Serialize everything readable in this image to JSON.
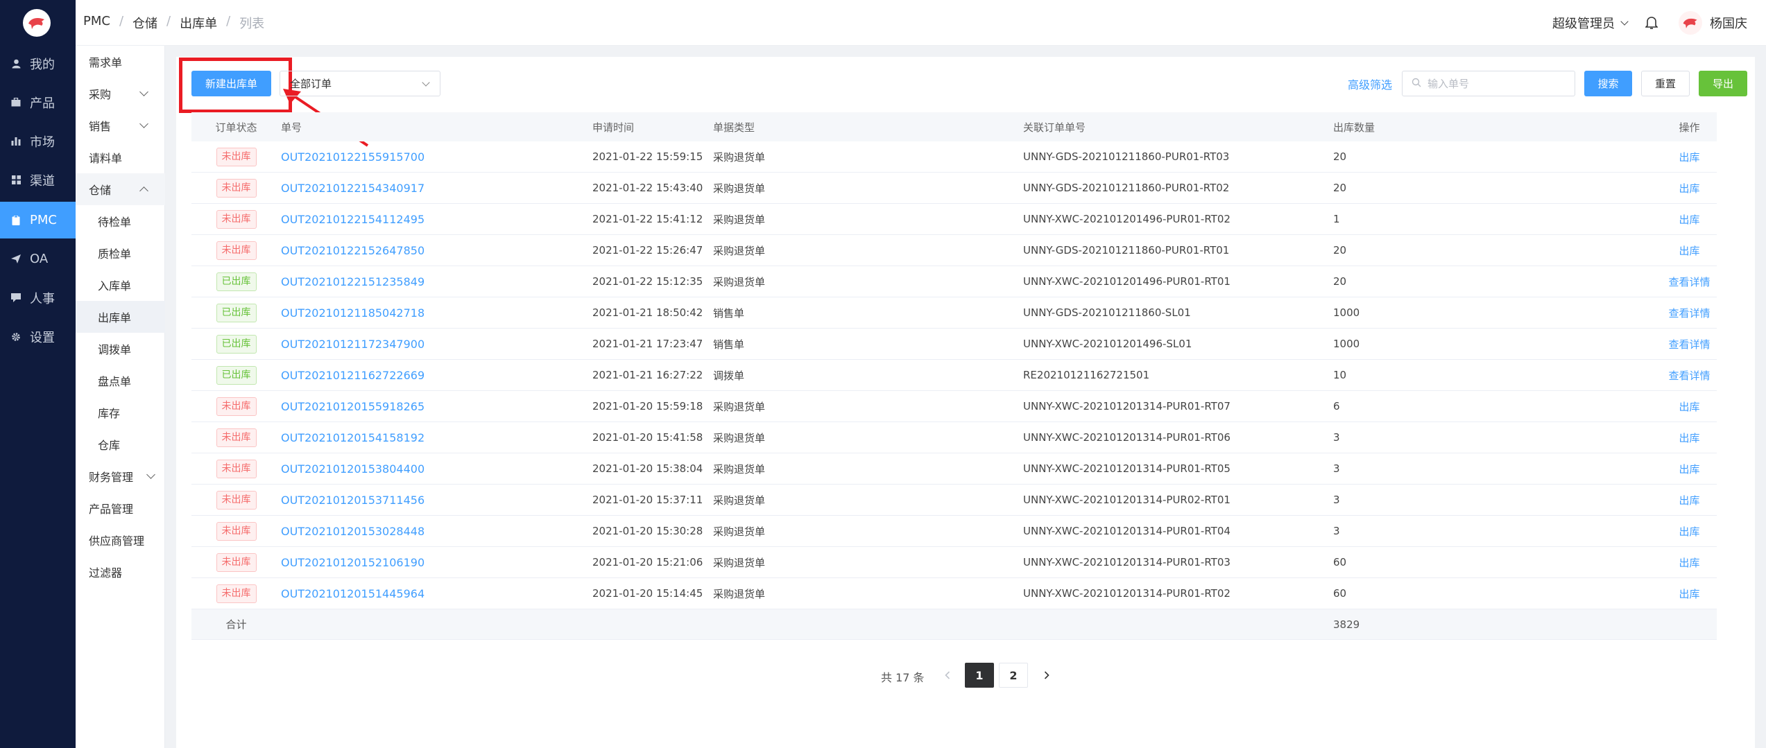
{
  "nav": {
    "items": [
      {
        "label": "我的",
        "icon": "user-icon"
      },
      {
        "label": "产品",
        "icon": "briefcase-icon"
      },
      {
        "label": "市场",
        "icon": "bar-chart-icon"
      },
      {
        "label": "渠道",
        "icon": "grid-icon"
      },
      {
        "label": "PMC",
        "icon": "clipboard-icon"
      },
      {
        "label": "OA",
        "icon": "paper-plane-icon"
      },
      {
        "label": "人事",
        "icon": "chat-icon"
      },
      {
        "label": "设置",
        "icon": "gear-icon"
      }
    ]
  },
  "sub": {
    "items": [
      "需求单",
      "采购",
      "销售",
      "请料单",
      "仓储",
      "待检单",
      "质检单",
      "入库单",
      "出库单",
      "调拨单",
      "盘点单",
      "库存",
      "仓库",
      "财务管理",
      "产品管理",
      "供应商管理",
      "过滤器"
    ]
  },
  "header": {
    "crumbs": [
      "PMC",
      "仓储",
      "出库单",
      "列表"
    ],
    "admin": "超级管理员",
    "username": "杨国庆"
  },
  "toolbar": {
    "new_label": "新建出库单",
    "filter_value": "全部订单",
    "advanced": "高级筛选",
    "search_placeholder": "输入单号",
    "search_label": "搜索",
    "reset_label": "重置",
    "export_label": "导出"
  },
  "table": {
    "columns": [
      "订单状态",
      "单号",
      "申请时间",
      "单据类型",
      "关联订单单号",
      "出库数量",
      "操作"
    ],
    "rows": [
      {
        "status": "未出库",
        "no": "OUT2021012215591570​0",
        "time": "2021-01-22 15:59:15",
        "type": "采购退货单",
        "ref": "UNNY-GDS-202101211860-PUR01-RT03",
        "qty": "20",
        "op": "出库"
      },
      {
        "status": "未出库",
        "no": "OUT20210122154340917",
        "time": "2021-01-22 15:43:40",
        "type": "采购退货单",
        "ref": "UNNY-GDS-202101211860-PUR01-RT02",
        "qty": "20",
        "op": "出库"
      },
      {
        "status": "未出库",
        "no": "OUT20210122154112495",
        "time": "2021-01-22 15:41:12",
        "type": "采购退货单",
        "ref": "UNNY-XWC-202101201496-PUR01-RT02",
        "qty": "1",
        "op": "出库"
      },
      {
        "status": "未出库",
        "no": "OUT20210122152647850",
        "time": "2021-01-22 15:26:47",
        "type": "采购退货单",
        "ref": "UNNY-GDS-202101211860-PUR01-RT01",
        "qty": "20",
        "op": "出库"
      },
      {
        "status": "已出库",
        "no": "OUT20210122151235849",
        "time": "2021-01-22 15:12:35",
        "type": "采购退货单",
        "ref": "UNNY-XWC-202101201496-PUR01-RT01",
        "qty": "20",
        "op": "查看详情"
      },
      {
        "status": "已出库",
        "no": "OUT20210121185042718",
        "time": "2021-01-21 18:50:42",
        "type": "销售单",
        "ref": "UNNY-GDS-202101211860-SL01",
        "qty": "1000",
        "op": "查看详情"
      },
      {
        "status": "已出库",
        "no": "OUT20210121172347900",
        "time": "2021-01-21 17:23:47",
        "type": "销售单",
        "ref": "UNNY-XWC-202101201496-SL01",
        "qty": "1000",
        "op": "查看详情"
      },
      {
        "status": "已出库",
        "no": "OUT20210121162722669",
        "time": "2021-01-21 16:27:22",
        "type": "调拨单",
        "ref": "RE20210121162721501",
        "qty": "10",
        "op": "查看详情"
      },
      {
        "status": "未出库",
        "no": "OUT20210120155918265",
        "time": "2021-01-20 15:59:18",
        "type": "采购退货单",
        "ref": "UNNY-XWC-202101201314-PUR01-RT07",
        "qty": "6",
        "op": "出库"
      },
      {
        "status": "未出库",
        "no": "OUT20210120154158192",
        "time": "2021-01-20 15:41:58",
        "type": "采购退货单",
        "ref": "UNNY-XWC-202101201314-PUR01-RT06",
        "qty": "3",
        "op": "出库"
      },
      {
        "status": "未出库",
        "no": "OUT20210120153804400",
        "time": "2021-01-20 15:38:04",
        "type": "采购退货单",
        "ref": "UNNY-XWC-202101201314-PUR01-RT05",
        "qty": "3",
        "op": "出库"
      },
      {
        "status": "未出库",
        "no": "OUT20210120153711456",
        "time": "2021-01-20 15:37:11",
        "type": "采购退货单",
        "ref": "UNNY-XWC-202101201314-PUR02-RT01",
        "qty": "3",
        "op": "出库"
      },
      {
        "status": "未出库",
        "no": "OUT20210120153028448",
        "time": "2021-01-20 15:30:28",
        "type": "采购退货单",
        "ref": "UNNY-XWC-202101201314-PUR01-RT04",
        "qty": "3",
        "op": "出库"
      },
      {
        "status": "未出库",
        "no": "OUT20210120152106190",
        "time": "2021-01-20 15:21:06",
        "type": "采购退货单",
        "ref": "UNNY-XWC-202101201314-PUR01-RT03",
        "qty": "60",
        "op": "出库"
      },
      {
        "status": "未出库",
        "no": "OUT20210120151445964",
        "time": "2021-01-20 15:14:45",
        "type": "采购退货单",
        "ref": "UNNY-XWC-202101201314-PUR01-RT02",
        "qty": "60",
        "op": "出库"
      }
    ],
    "footer_label": "合计",
    "footer_qty": "3829"
  },
  "pager": {
    "total": "共 17 条",
    "pages": [
      "1",
      "2"
    ]
  },
  "colors": {
    "accent": "#409eff",
    "nav_bg": "#0f1b3d",
    "export": "#67c23a",
    "highlight": "#ea1c24"
  }
}
